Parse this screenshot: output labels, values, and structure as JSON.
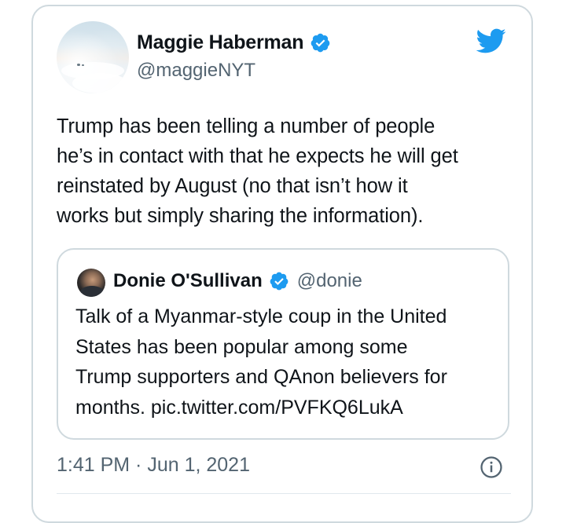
{
  "tweet": {
    "author": {
      "name": "Maggie Haberman",
      "handle": "@maggieNYT",
      "verified": true
    },
    "text": "Trump has been telling a number of people\nhe’s in contact with that he expects he will get\nreinstated by August (no that isn’t how it\nworks but simply sharing the information).",
    "timestamp": "1:41 PM · Jun 1, 2021",
    "brand_color": "#1d9bf0"
  },
  "quoted": {
    "author": {
      "name": "Donie O'Sullivan",
      "handle": "@donie",
      "verified": true
    },
    "text": "Talk of a Myanmar-style coup in the United\nStates has been popular among some\nTrump supporters and QAnon believers for\nmonths. pic.twitter.com/PVFKQ6LukA"
  },
  "icons": {
    "logo": "twitter-bird-icon",
    "verified": "verified-badge-icon",
    "info": "info-icon"
  }
}
